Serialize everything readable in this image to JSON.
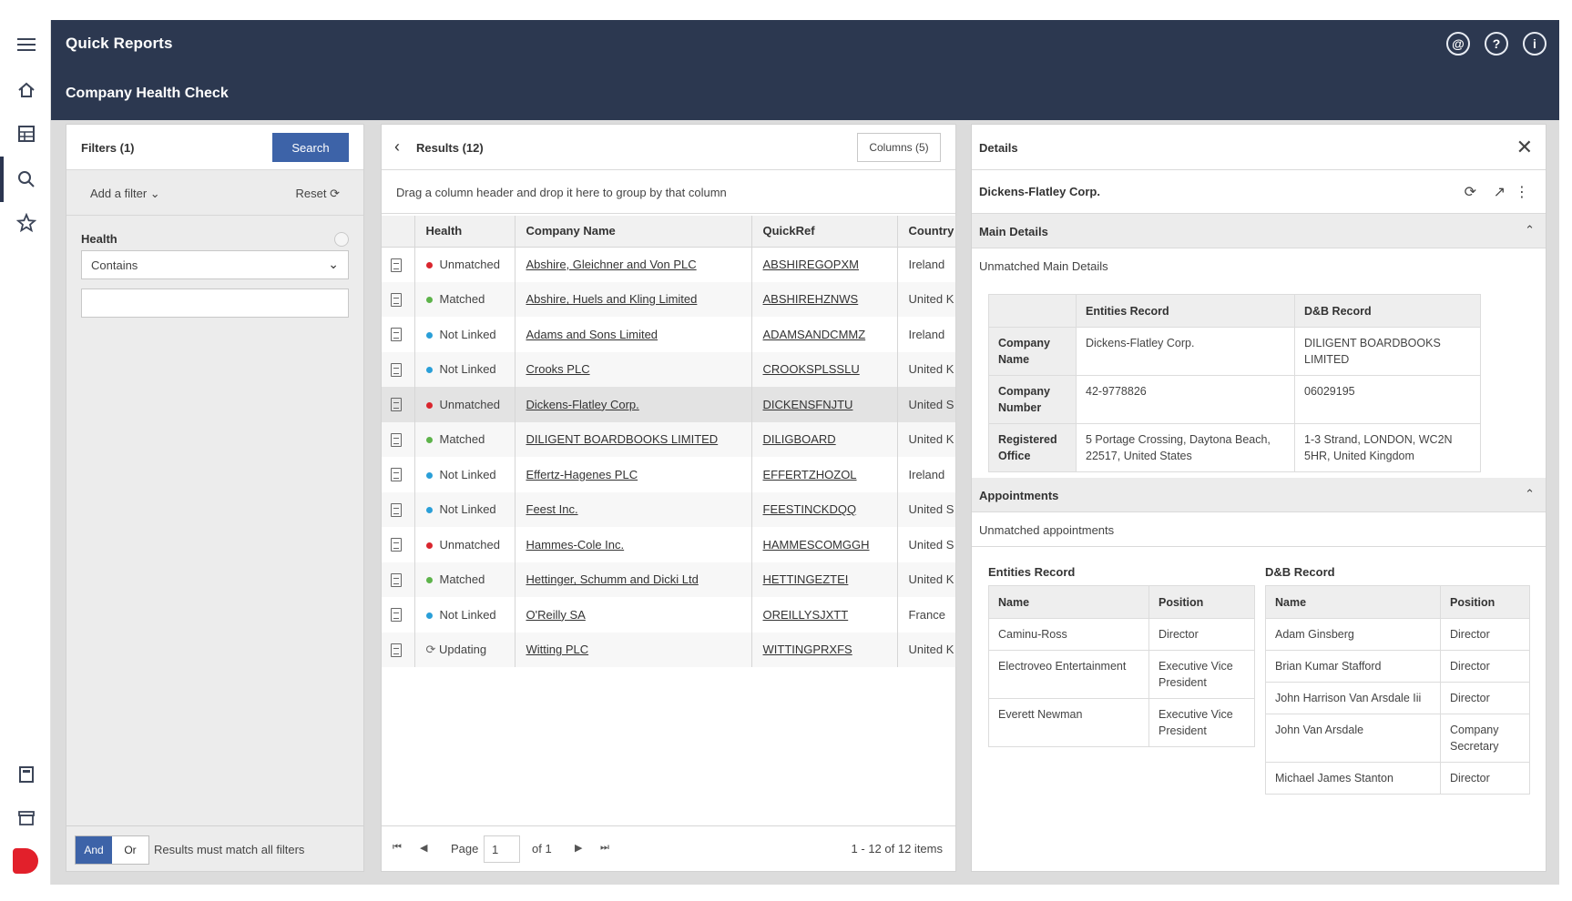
{
  "app": {
    "title": "Quick Reports",
    "page_title": "Company Health Check"
  },
  "filters": {
    "header": "Filters (1)",
    "search_label": "Search",
    "add_filter_label": "Add a filter",
    "reset_label": "Reset",
    "field_label": "Health",
    "operator": "Contains",
    "value": "",
    "logic": {
      "and_label": "And",
      "or_label": "Or",
      "selected": "And"
    },
    "footer_note": "Results must match all filters"
  },
  "results": {
    "header": "Results (12)",
    "columns_label": "Columns (5)",
    "group_hint": "Drag a column header and drop it here to group by that column",
    "columns": [
      "Health",
      "Company Name",
      "QuickRef",
      "Country"
    ],
    "rows": [
      {
        "health": "Unmatched",
        "company": "Abshire, Gleichner and Von PLC",
        "quickref": "ABSHIREGOPXM",
        "country": "Ireland"
      },
      {
        "health": "Matched",
        "company": "Abshire, Huels and Kling Limited",
        "quickref": "ABSHIREHZNWS",
        "country": "United K"
      },
      {
        "health": "Not Linked",
        "company": "Adams and Sons Limited",
        "quickref": "ADAMSANDCMMZ",
        "country": "Ireland"
      },
      {
        "health": "Not Linked",
        "company": "Crooks PLC",
        "quickref": "CROOKSPLSSLU",
        "country": "United K"
      },
      {
        "health": "Unmatched",
        "company": "Dickens-Flatley Corp.",
        "quickref": "DICKENSFNJTU",
        "country": "United S"
      },
      {
        "health": "Matched",
        "company": "DILIGENT BOARDBOOKS LIMITED",
        "quickref": "DILIGBOARD",
        "country": "United K"
      },
      {
        "health": "Not Linked",
        "company": "Effertz-Hagenes PLC",
        "quickref": "EFFERTZHOZOL",
        "country": "Ireland"
      },
      {
        "health": "Not Linked",
        "company": "Feest Inc.",
        "quickref": "FEESTINCKDQQ",
        "country": "United S"
      },
      {
        "health": "Unmatched",
        "company": "Hammes-Cole Inc.",
        "quickref": "HAMMESCOMGGH",
        "country": "United S"
      },
      {
        "health": "Matched",
        "company": "Hettinger, Schumm and Dicki Ltd",
        "quickref": "HETTINGEZTEI",
        "country": "United K"
      },
      {
        "health": "Not Linked",
        "company": "O'Reilly SA",
        "quickref": "OREILLYSJXTT",
        "country": "France"
      },
      {
        "health": "Updating",
        "company": "Witting PLC",
        "quickref": "WITTINGPRXFS",
        "country": "United K"
      }
    ],
    "selected_index": 4,
    "pager": {
      "page_label": "Page",
      "page_value": "1",
      "of_label": "of 1",
      "count_label": "1 - 12 of 12 items"
    }
  },
  "health_colors": {
    "Unmatched": "#d9262e",
    "Matched": "#5db34a",
    "Not Linked": "#2a9fd8",
    "Updating": "#888888"
  },
  "details": {
    "header": "Details",
    "company": "Dickens-Flatley Corp.",
    "main": {
      "title": "Main Details",
      "note": "Unmatched Main Details",
      "col_entities": "Entities Record",
      "col_db": "D&B Record",
      "rows": [
        {
          "label": "Company Name",
          "entities": "Dickens-Flatley Corp.",
          "db": "DILIGENT BOARDBOOKS LIMITED"
        },
        {
          "label": "Company Number",
          "entities": "42-9778826",
          "db": "06029195"
        },
        {
          "label": "Registered Office",
          "entities": "5 Portage Crossing, Daytona Beach, 22517, United States",
          "db": "1-3 Strand, LONDON, WC2N 5HR, United Kingdom"
        }
      ]
    },
    "appointments": {
      "title": "Appointments",
      "note": "Unmatched appointments",
      "entities_label": "Entities Record",
      "db_label": "D&B Record",
      "col_name": "Name",
      "col_position": "Position",
      "entities": [
        {
          "name": "Caminu-Ross",
          "position": "Director"
        },
        {
          "name": "Electroveo Entertainment",
          "position": "Executive Vice President"
        },
        {
          "name": "Everett Newman",
          "position": "Executive Vice President"
        }
      ],
      "db": [
        {
          "name": "Adam Ginsberg",
          "position": "Director"
        },
        {
          "name": "Brian Kumar Stafford",
          "position": "Director"
        },
        {
          "name": "John Harrison Van Arsdale Iii",
          "position": "Director"
        },
        {
          "name": "John Van Arsdale",
          "position": "Company Secretary"
        },
        {
          "name": "Michael James Stanton",
          "position": "Director"
        }
      ]
    }
  }
}
